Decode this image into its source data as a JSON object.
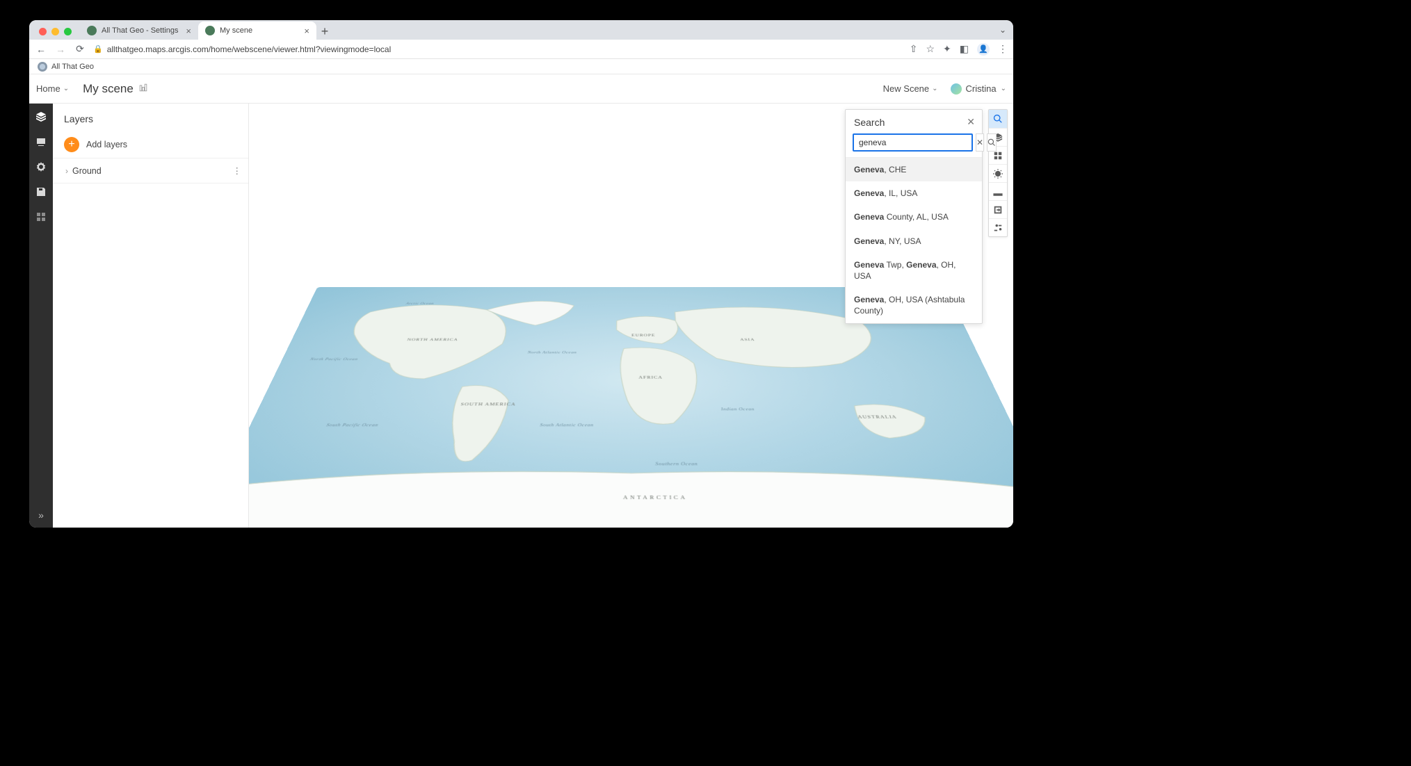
{
  "browser": {
    "tabs": [
      {
        "title": "All That Geo - Settings",
        "active": false
      },
      {
        "title": "My scene",
        "active": true
      }
    ],
    "url": "allthatgeo.maps.arcgis.com/home/webscene/viewer.html?viewingmode=local",
    "bookmark": "All That Geo"
  },
  "header": {
    "home": "Home",
    "scene_title": "My scene",
    "new_scene": "New Scene",
    "user": "Cristina"
  },
  "sidebar": {
    "title": "Layers",
    "add_layers": "Add layers",
    "ground": "Ground"
  },
  "right_toolbar_icons": [
    "search-icon",
    "layers-icon",
    "basemap-icon",
    "daylight-icon",
    "measure-icon",
    "share-icon",
    "settings-gear-icon"
  ],
  "search": {
    "title": "Search",
    "value": "geneva",
    "results": [
      {
        "bold": "Geneva",
        "rest": ", CHE"
      },
      {
        "bold": "Geneva",
        "rest": ", IL, USA"
      },
      {
        "bold": "Geneva",
        "rest": " County, AL, USA"
      },
      {
        "bold": "Geneva",
        "rest": ", NY, USA"
      },
      {
        "bold": "Geneva",
        "rest": " Twp, ",
        "bold2": "Geneva",
        "rest2": ", OH, USA"
      },
      {
        "bold": "Geneva",
        "rest": ", OH, USA (Ashtabula County)"
      }
    ]
  },
  "map_labels": {
    "north_america": "NORTH AMERICA",
    "south_america": "SOUTH AMERICA",
    "europe": "EUROPE",
    "africa": "AFRICA",
    "asia": "ASIA",
    "australia": "AUSTRALIA",
    "antarctica": "ANTARCTICA",
    "arctic": "Arctic Ocean",
    "n_atlantic": "North Atlantic Ocean",
    "s_atlantic": "South Atlantic Ocean",
    "n_pacific": "North Pacific Ocean",
    "s_pacific": "South Pacific Ocean",
    "indian": "Indian Ocean",
    "southern": "Southern Ocean"
  }
}
